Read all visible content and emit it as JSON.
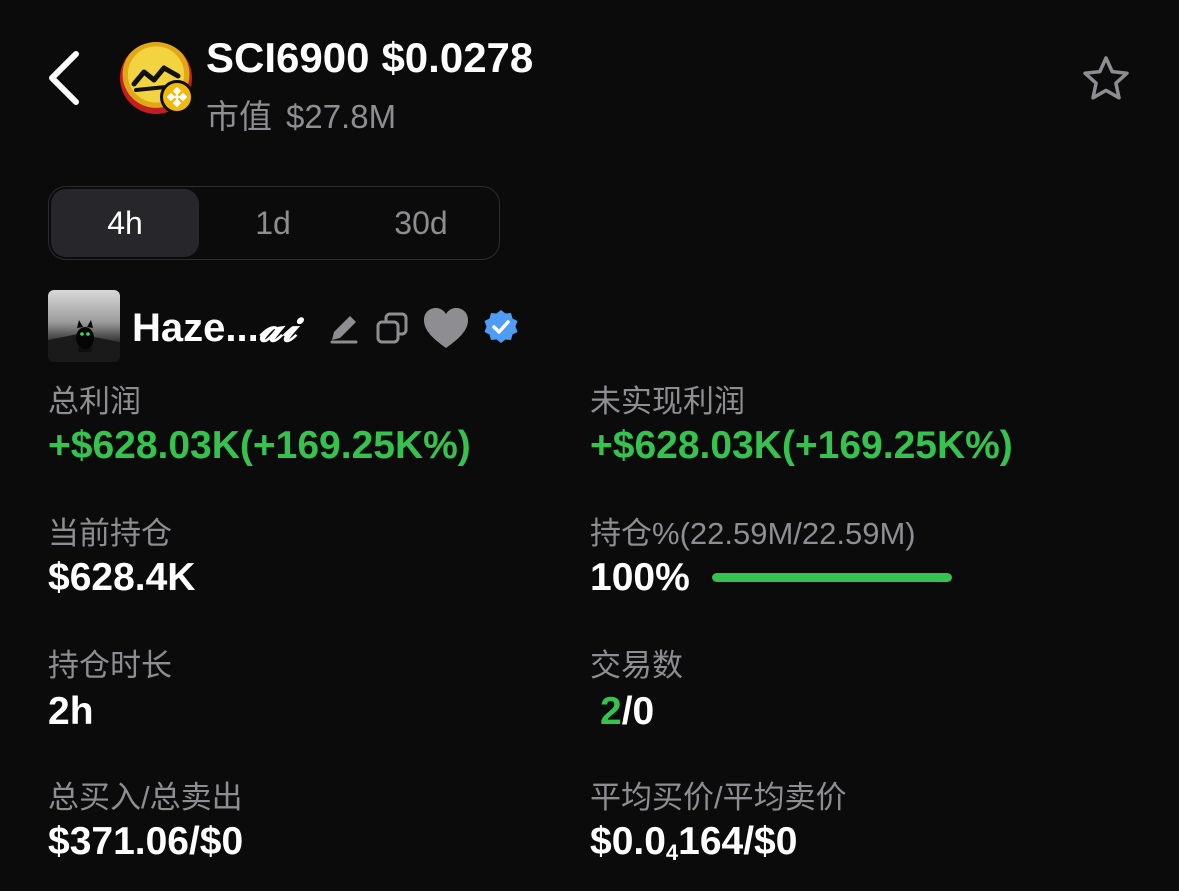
{
  "header": {
    "symbol": "SCI6900",
    "price": "$0.0278",
    "mcap_label": "市值",
    "mcap_value": "$27.8M"
  },
  "tabs": [
    {
      "label": "4h",
      "active": true
    },
    {
      "label": "1d",
      "active": false
    },
    {
      "label": "30d",
      "active": false
    }
  ],
  "user": {
    "name_prefix": "Haze...",
    "name_suffix": "𝓪𝓲"
  },
  "stats": {
    "total_profit": {
      "label": "总利润",
      "value": "+$628.03K(+169.25K%)"
    },
    "unrealized_profit": {
      "label": "未实现利润",
      "value": "+$628.03K(+169.25K%)"
    },
    "current_holding": {
      "label": "当前持仓",
      "value": "$628.4K"
    },
    "holding_pct": {
      "label": "持仓%(22.59M/22.59M)",
      "value": "100%",
      "fill_fraction": 1.0
    },
    "holding_duration": {
      "label": "持仓时长",
      "value": "2h"
    },
    "trades": {
      "label": "交易数",
      "buys": "2",
      "sells": "/0"
    },
    "total_buy_sell": {
      "label": "总买入/总卖出",
      "value": "$371.06/$0"
    },
    "avg_price": {
      "label": "平均买价/平均卖价",
      "prefix": "$0.0",
      "zeros_sub": "4",
      "suffix": "164/$0"
    }
  },
  "colors": {
    "background": "#0b0b0c",
    "profit_green": "#35c24e",
    "muted_text": "#8d8d92",
    "verified_blue": "#4f9cf5",
    "chain_badge": "#f0b90b"
  },
  "icons": [
    "back-arrow-icon",
    "token-logo-icon",
    "bnb-chain-icon",
    "star-icon",
    "edit-pencil-icon",
    "copy-icon",
    "heart-icon",
    "verified-badge-icon"
  ]
}
